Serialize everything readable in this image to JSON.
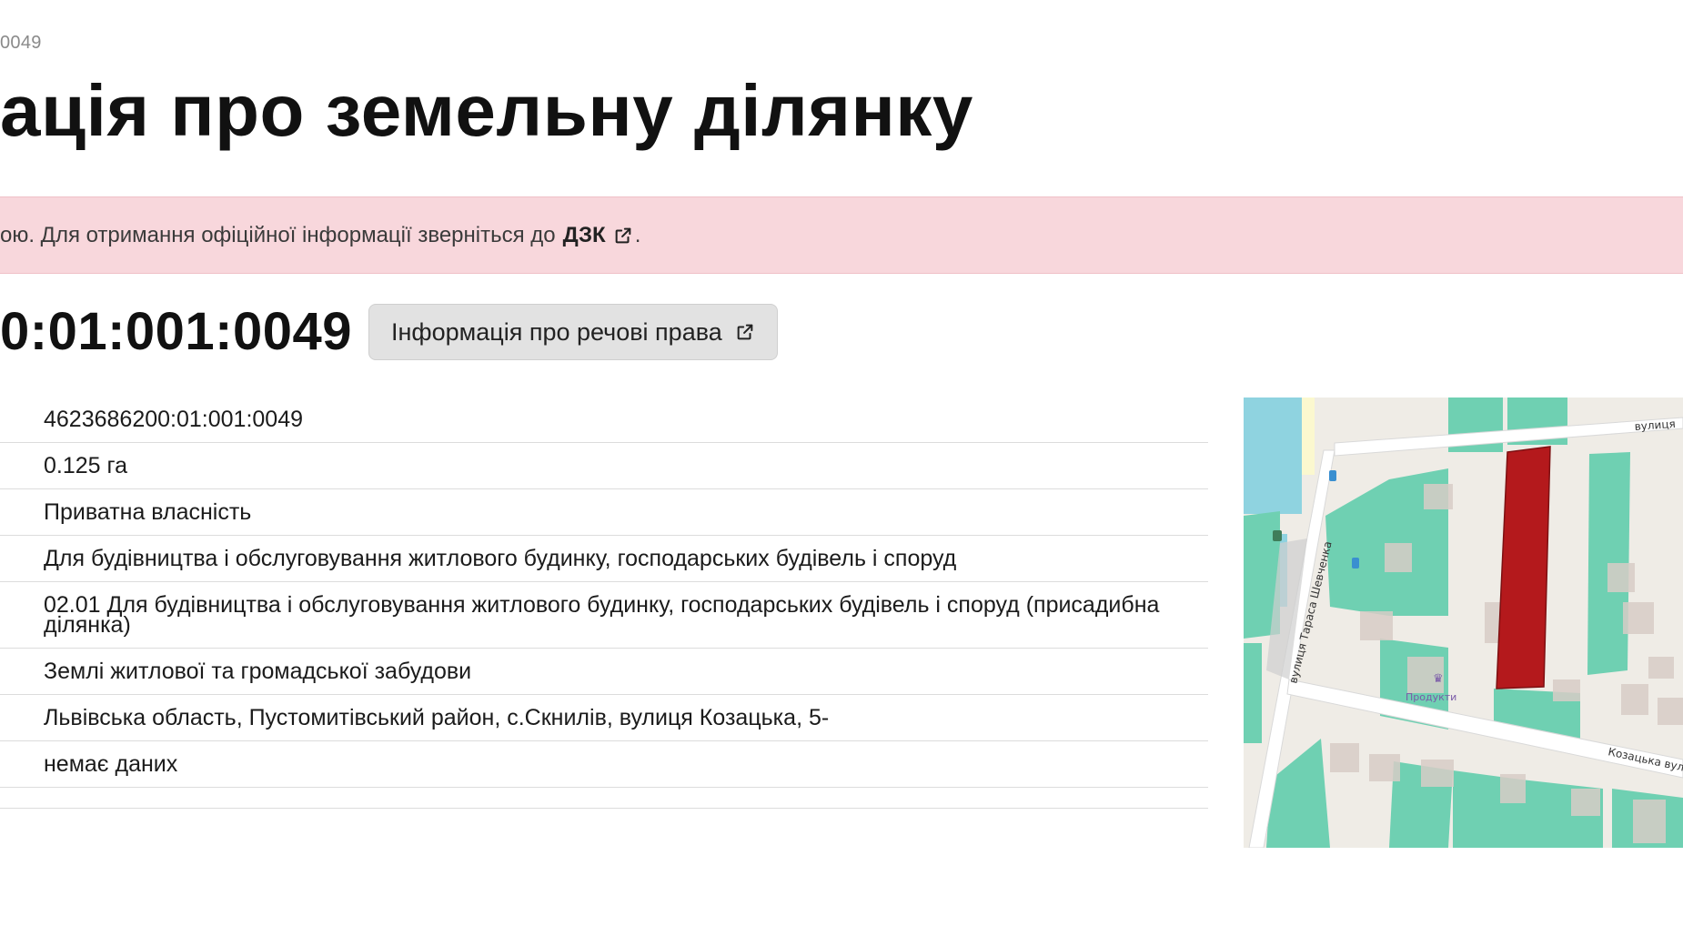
{
  "breadcrumb": "0049",
  "title": "ація про земельну ділянку",
  "notice": {
    "text": "ою. Для отримання офіційної інформації зверніться до",
    "link_label": "ДЗК",
    "link_icon": "external-link-icon",
    "period": "."
  },
  "cadastre": {
    "number": "0:01:001:0049",
    "rights_button_label": "Інформація про речові права",
    "rights_button_icon": "external-link-icon"
  },
  "details": [
    "4623686200:01:001:0049",
    "0.125 га",
    "Приватна власність",
    "Для будівництва і обслуговування житлового будинку, господарських будівель і споруд",
    "02.01 Для будівництва і обслуговування житлового будинку, господарських будівель і споруд (присадибна ділянка)",
    "Землі житлової та громадської забудови",
    "Львівська область, Пустомитівський район, с.Скнилів, вулиця Козацька, 5-",
    "немає даних"
  ],
  "map": {
    "street_1": "вулиця Тараса Шевченка",
    "street_2": "Козацька вул",
    "street_3": "вулиця",
    "poi_label": "Продукти",
    "colors": {
      "parcel": "#6fd0b2",
      "selected": "#b4191c",
      "water": "#8fd3e0",
      "road": "#ffffff",
      "building": "#d7cdc6"
    }
  }
}
